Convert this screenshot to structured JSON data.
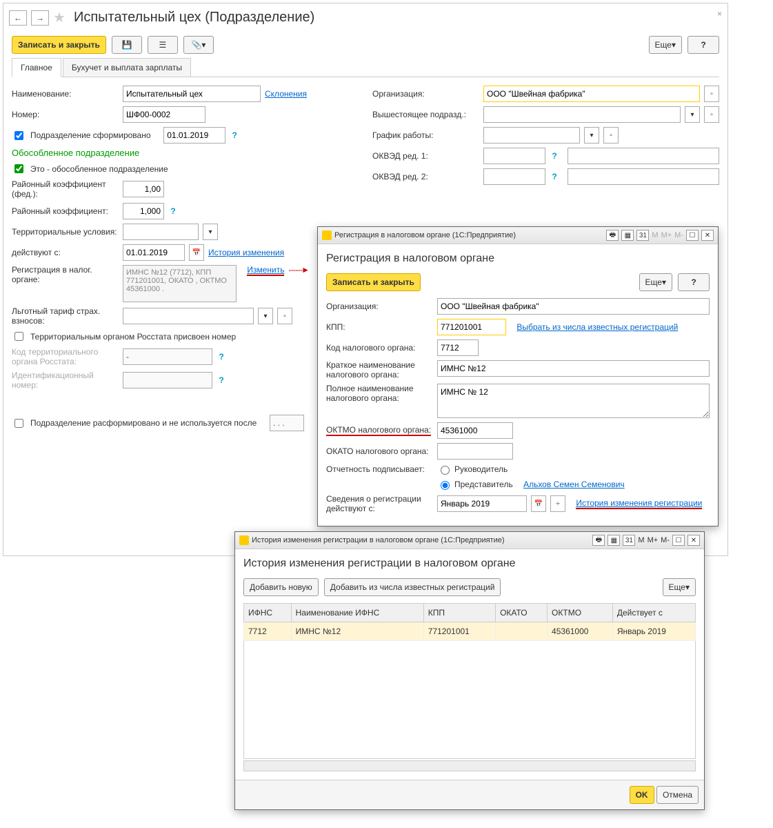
{
  "main": {
    "title": "Испытательный цех (Подразделение)",
    "save_close": "Записать и закрыть",
    "more": "Еще",
    "tabs": {
      "main": "Главное",
      "buh": "Бухучет и выплата зарплаты"
    },
    "left": {
      "name_lbl": "Наименование:",
      "name_val": "Испытательный цех",
      "declensions": "Склонения",
      "num_lbl": "Номер:",
      "num_val": "ШФ00-0002",
      "formed_lbl": "Подразделение сформировано",
      "formed_date": "01.01.2019",
      "sep_section": "Обособленное подразделение",
      "sep_cb": "Это - обособленное подразделение",
      "rk_fed_lbl": "Районный коэффициент (фед.):",
      "rk_fed_val": "1,00",
      "rk_lbl": "Районный коэффициент:",
      "rk_val": "1,000",
      "terr_lbl": "Территориальные условия:",
      "valid_lbl": "действуют с:",
      "valid_date": "01.01.2019",
      "history": "История изменения",
      "reg_lbl": "Регистрация в налог. органе:",
      "reg_text": "ИМНС №12 (7712), КПП 771201001, ОКАТО , ОКТМО 45361000   .",
      "change": "Изменить",
      "tarif_lbl": "Льготный тариф страх. взносов:",
      "rosstat_cb": "Территориальным органом Росстата присвоен номер",
      "rosstat_code_lbl": "Код территориального органа Росстата:",
      "rosstat_code_val": "-",
      "ident_lbl": "Идентификационный номер:",
      "disbanded_lbl": "Подразделение расформировано и не используется после",
      "disbanded_val": ". . ."
    },
    "right": {
      "org_lbl": "Организация:",
      "org_val": "ООО \"Швейная фабрика\"",
      "parent_lbl": "Вышестоящее подразд.:",
      "schedule_lbl": "График работы:",
      "okved1_lbl": "ОКВЭД ред. 1:",
      "okved2_lbl": "ОКВЭД ред. 2:"
    }
  },
  "dlg1": {
    "winbar": "Регистрация в налоговом органе  (1С:Предприятие)",
    "title": "Регистрация в налоговом органе",
    "save_close": "Записать и закрыть",
    "more": "Еще",
    "org_lbl": "Организация:",
    "org_val": "ООО \"Швейная фабрика\"",
    "kpp_lbl": "КПП:",
    "kpp_val": "771201001",
    "known": "Выбрать из числа известных регистраций",
    "code_lbl": "Код налогового органа:",
    "code_val": "7712",
    "short_lbl": "Краткое наименование налогового органа:",
    "short_val": "ИМНС №12",
    "full_lbl": "Полное наименование налогового органа:",
    "full_val": "ИМНС № 12",
    "oktmo_lbl": "ОКТМО налогового органа:",
    "oktmo_val": "45361000",
    "okato_lbl": "ОКАТО налогового органа:",
    "sign_lbl": "Отчетность подписывает:",
    "sign_r1": "Руководитель",
    "sign_r2": "Представитель",
    "rep": "Альхов Семен Семенович",
    "valid_lbl": "Сведения о регистрации действуют с:",
    "valid_val": "Январь 2019",
    "hist": "История изменения регистрации"
  },
  "dlg2": {
    "winbar": "История изменения регистрации в налоговом органе  (1С:Предприятие)",
    "title": "История изменения регистрации в налоговом органе",
    "add_new": "Добавить новую",
    "add_known": "Добавить из числа известных регистраций",
    "more": "Еще",
    "cols": {
      "ifns": "ИФНС",
      "name": "Наименование ИФНС",
      "kpp": "КПП",
      "okato": "ОКАТО",
      "oktmo": "ОКТМО",
      "valid": "Действует с"
    },
    "row": {
      "ifns": "7712",
      "name": "ИМНС №12",
      "kpp": "771201001",
      "okato": "",
      "oktmo": "45361000",
      "valid": "Январь 2019"
    },
    "ok": "OK",
    "cancel": "Отмена"
  },
  "win": {
    "m": "M",
    "mp": "M+",
    "mm": "M-"
  }
}
